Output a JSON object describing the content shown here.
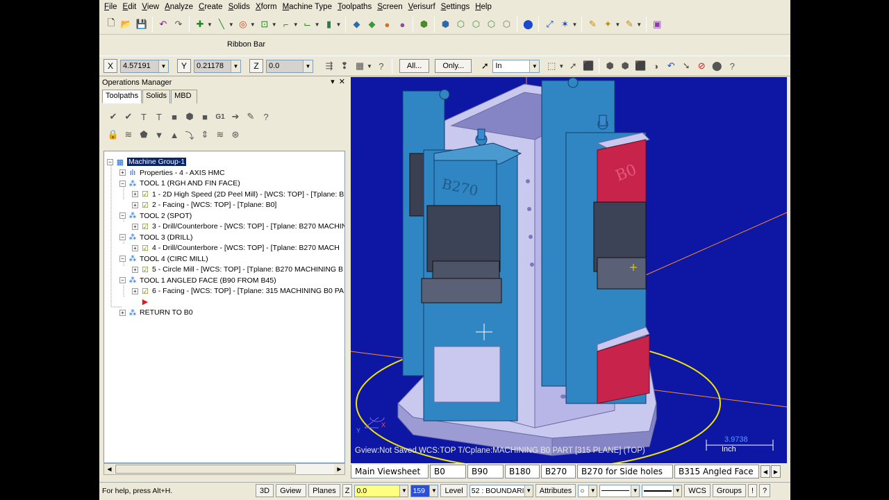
{
  "menu": [
    "File",
    "Edit",
    "View",
    "Analyze",
    "Create",
    "Solids",
    "Xform",
    "Machine Type",
    "Toolpaths",
    "Screen",
    "Verisurf",
    "Settings",
    "Help"
  ],
  "ribbon_label": "Ribbon Bar",
  "coords": {
    "x_label": "X",
    "x_value": "4.57191",
    "y_label": "Y",
    "y_value": "0.21178",
    "z_label": "Z",
    "z_value": "0.0"
  },
  "ribbon_buttons": {
    "all": "All...",
    "only": "Only..."
  },
  "units_select": "In",
  "ops_manager": {
    "title": "Operations Manager",
    "close": "✕",
    "pin": "▾",
    "tabs": [
      "Toolpaths",
      "Solids",
      "MBD"
    ],
    "tree": [
      {
        "text": "Machine Group-1",
        "level": 0,
        "icon": "machine-group-icon",
        "selected": true
      },
      {
        "text": "Properties - 4 - AXIS HMC",
        "level": 1,
        "icon": "properties-icon"
      },
      {
        "text": "TOOL 1 (RGH AND FIN FACE)",
        "level": 1,
        "icon": "tool-group-icon"
      },
      {
        "text": "1 - 2D High Speed (2D Peel Mill) - [WCS: TOP] - [Tplane: B",
        "level": 2,
        "icon": "operation-icon"
      },
      {
        "text": "2 - Facing - [WCS: TOP] - [Tplane: B0]",
        "level": 2,
        "icon": "operation-icon"
      },
      {
        "text": "TOOL 2 (SPOT)",
        "level": 1,
        "icon": "tool-group-icon"
      },
      {
        "text": "3 - Drill/Counterbore - [WCS: TOP] - [Tplane: B270 MACHIN",
        "level": 2,
        "icon": "operation-icon"
      },
      {
        "text": "TOOL 3 (DRILL)",
        "level": 1,
        "icon": "tool-group-icon"
      },
      {
        "text": "4 - Drill/Counterbore - [WCS: TOP] - [Tplane: B270 MACH",
        "level": 2,
        "icon": "operation-icon"
      },
      {
        "text": "TOOL 4 (CIRC MILL)",
        "level": 1,
        "icon": "tool-group-icon"
      },
      {
        "text": "5 - Circle Mill - [WCS: TOP] - [Tplane: B270 MACHINING B",
        "level": 2,
        "icon": "operation-icon"
      },
      {
        "text": "TOOL 1 ANGLED FACE (B90 FROM B45)",
        "level": 1,
        "icon": "tool-group-icon"
      },
      {
        "text": "6 - Facing - [WCS: TOP] - [Tplane: 315 MACHINING B0 PA",
        "level": 2,
        "icon": "operation-icon"
      },
      {
        "text": "",
        "level": 2,
        "icon": "insert-arrow-icon"
      },
      {
        "text": "RETURN TO B0",
        "level": 1,
        "icon": "tool-group-icon"
      }
    ]
  },
  "viewport": {
    "status": "Gview:Not Saved    WCS:TOP    T/Cplane:MACHINING B0 PART [315 PLANE] (TOP)",
    "scale_value": "3.9738",
    "scale_unit": "Inch",
    "part_labels": [
      "B270",
      "B0"
    ]
  },
  "view_tabs": [
    "Main Viewsheet",
    "B0",
    "B90",
    "B180",
    "B270",
    "B270 for  Side holes",
    "B315 Angled Face"
  ],
  "statusbar": {
    "help": "For help, press Alt+H.",
    "btn_3d": "3D",
    "btn_gview": "Gview",
    "btn_planes": "Planes",
    "z_label": "Z",
    "z_value": "0.0",
    "color_value": "159",
    "level_label": "Level",
    "level_value": "52 : BOUNDARII",
    "attributes": "Attributes",
    "point_style": "○",
    "wcs": "WCS",
    "groups": "Groups",
    "pipe": "!",
    "question": "?"
  },
  "colors": {
    "viewport_bg": "#0e17a4",
    "fixture_blue": "#2f86c2",
    "part_red": "#c8234a",
    "base_lavender": "#c9c8ef",
    "ui_bg": "#ece9d8"
  }
}
